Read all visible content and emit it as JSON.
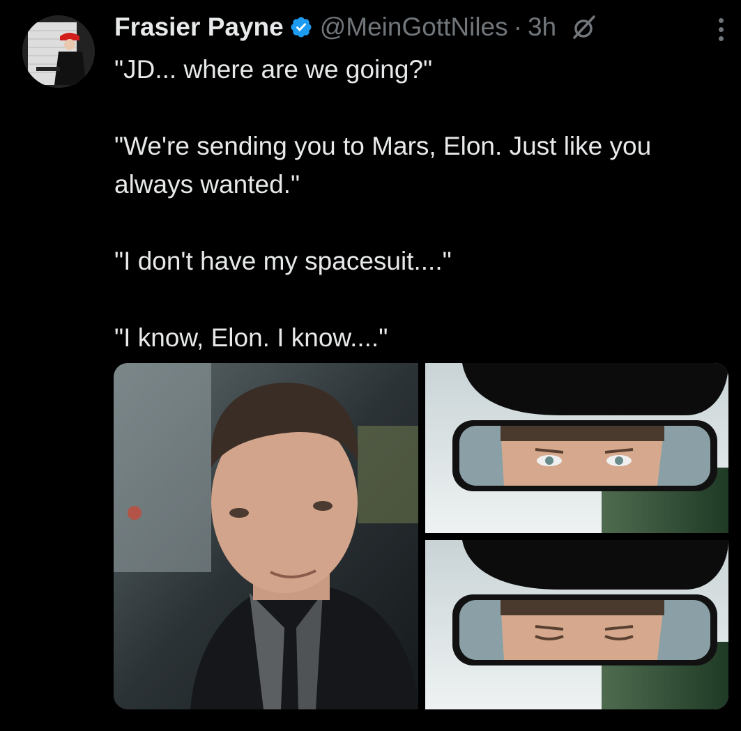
{
  "post": {
    "author_name": "Frasier Payne",
    "handle": "@MeinGottNiles",
    "separator": "·",
    "time": "3h",
    "lines": [
      "\"JD... where are we going?\"",
      "\"We're sending you to Mars, Elon. Just like you always wanted.\"",
      "\"I don't have my spacesuit....\"",
      "\"I know, Elon. I know....\""
    ]
  },
  "icons": {
    "verified": "verified-badge-icon",
    "grok": "grok-icon",
    "more": "more-options-icon"
  },
  "colors": {
    "background": "#000000",
    "text": "#e7e9ea",
    "muted": "#71767b",
    "verified": "#1d9bf0"
  }
}
